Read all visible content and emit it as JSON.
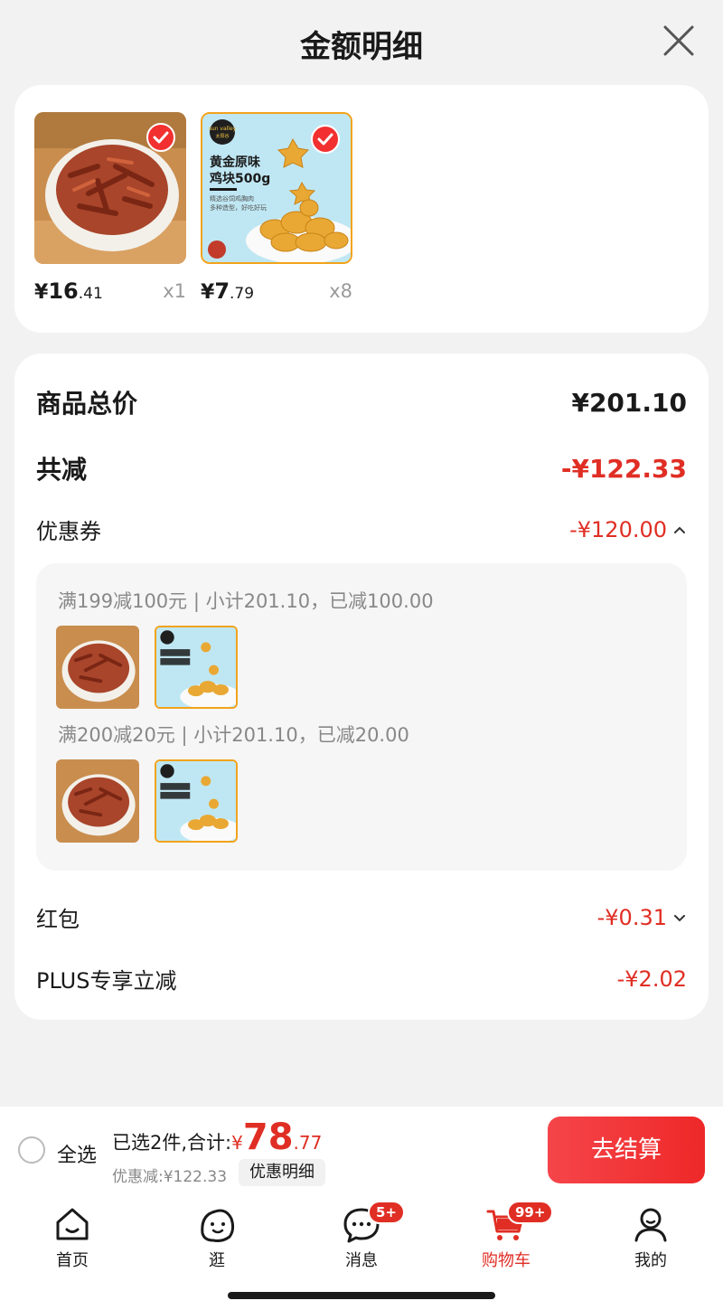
{
  "header": {
    "title": "金额明细"
  },
  "products": [
    {
      "price_symbol": "¥",
      "price_int": "16",
      "price_dec": ".41",
      "qty": "x1",
      "image": "braised-meat-strips-bowl"
    },
    {
      "price_symbol": "¥",
      "price_int": "7",
      "price_dec": ".79",
      "qty": "x8",
      "image": "golden-chicken-nuggets-500g",
      "package_text": {
        "brand": "sun valley",
        "brand_cn": "太阳谷",
        "name_line1": "黄金原味",
        "name_line2": "鸡块500g",
        "desc1": "精选谷饲鸡胸肉",
        "desc2": "多种造型，好吃好玩"
      }
    }
  ],
  "details": {
    "total_label": "商品总价",
    "total_value": "¥201.10",
    "reduce_label": "共减",
    "reduce_value": "-¥122.33",
    "coupon_label": "优惠券",
    "coupon_value": "-¥120.00",
    "coupon_groups": [
      {
        "text": "满199减100元 | 小计201.10，已减100.00"
      },
      {
        "text": "满200减20元 | 小计201.10，已减20.00"
      }
    ],
    "redpack_label": "红包",
    "redpack_value": "-¥0.31",
    "plus_label": "PLUS专享立减",
    "plus_value": "-¥2.02"
  },
  "bottom": {
    "select_all": "全选",
    "selected_text": "已选2件,合计:",
    "total_symbol": "¥",
    "total_int": "78",
    "total_dec": ".77",
    "savings": "优惠减:¥122.33",
    "detail_button": "优惠明细",
    "checkout_button": "去结算"
  },
  "tabs": [
    {
      "label": "首页",
      "icon": "home-icon"
    },
    {
      "label": "逛",
      "icon": "browse-icon"
    },
    {
      "label": "消息",
      "icon": "message-icon",
      "badge": "5+"
    },
    {
      "label": "购物车",
      "icon": "cart-icon",
      "badge": "99+",
      "active": true
    },
    {
      "label": "我的",
      "icon": "profile-icon"
    }
  ],
  "colors": {
    "accent": "#e02e24",
    "background": "#f2f2f2"
  }
}
